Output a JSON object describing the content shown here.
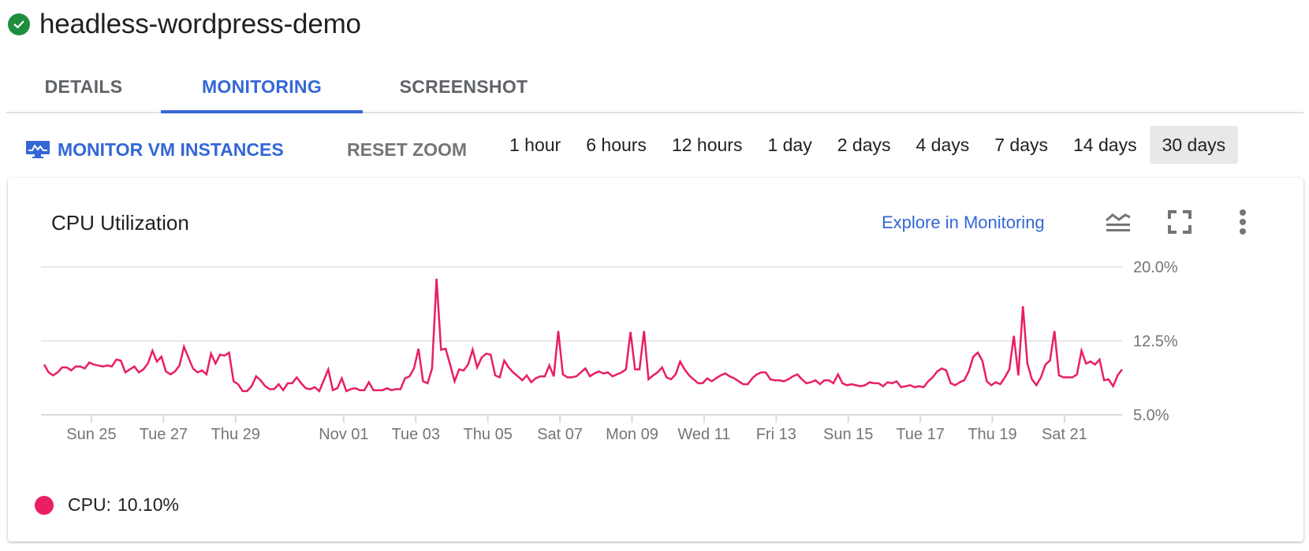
{
  "instance": {
    "name": "headless-wordpress-demo",
    "status_icon": "check-circle-icon",
    "status_color": "#1e8e3e"
  },
  "tabs": [
    {
      "label": "DETAILS",
      "active": false
    },
    {
      "label": "MONITORING",
      "active": true
    },
    {
      "label": "SCREENSHOT",
      "active": false
    }
  ],
  "toolbar": {
    "monitor_label": "MONITOR VM INSTANCES",
    "monitor_icon": "monitor-chart-icon",
    "reset_zoom_label": "RESET ZOOM",
    "ranges": [
      "1 hour",
      "6 hours",
      "12 hours",
      "1 day",
      "2 days",
      "4 days",
      "7 days",
      "14 days",
      "30 days"
    ],
    "selected_range": "30 days"
  },
  "card": {
    "title": "CPU Utilization",
    "explore_label": "Explore in Monitoring",
    "icons": [
      "legend-toggle-icon",
      "fullscreen-icon",
      "more-vert-icon"
    ]
  },
  "colors": {
    "accent": "#3367d6",
    "series": "#e91e63",
    "grid": "#e8e8e8",
    "axis_text": "#757575"
  },
  "legend": {
    "label": "CPU:",
    "value": "10.10%"
  },
  "chart_data": {
    "type": "line",
    "title": "CPU Utilization",
    "xlabel": "",
    "ylabel": "",
    "ylim": [
      5.0,
      20.0
    ],
    "yticks": [
      "5.0%",
      "12.5%",
      "20.0%"
    ],
    "ytick_values": [
      5.0,
      12.5,
      20.0
    ],
    "grid": true,
    "legend_position": "bottom-left",
    "x_range_days": [
      0,
      30
    ],
    "xticks": [
      {
        "label": "Sun 25",
        "day": 1.4
      },
      {
        "label": "Tue 27",
        "day": 3.4
      },
      {
        "label": "Thu 29",
        "day": 5.4
      },
      {
        "label": "Nov 01",
        "day": 8.4
      },
      {
        "label": "Tue 03",
        "day": 10.4
      },
      {
        "label": "Thu 05",
        "day": 12.4
      },
      {
        "label": "Sat 07",
        "day": 14.4
      },
      {
        "label": "Mon 09",
        "day": 16.4
      },
      {
        "label": "Wed 11",
        "day": 18.4
      },
      {
        "label": "Fri 13",
        "day": 20.4
      },
      {
        "label": "Sun 15",
        "day": 22.4
      },
      {
        "label": "Tue 17",
        "day": 24.4
      },
      {
        "label": "Thu 19",
        "day": 26.4
      },
      {
        "label": "Sat 21",
        "day": 28.4
      }
    ],
    "series": [
      {
        "name": "CPU",
        "color": "#e91e63",
        "values": [
          10.1,
          9.3,
          9.0,
          9.3,
          9.8,
          9.8,
          9.5,
          9.9,
          9.9,
          9.7,
          10.3,
          10.1,
          10.0,
          9.9,
          10.0,
          9.9,
          10.6,
          10.5,
          9.3,
          9.6,
          9.9,
          9.3,
          9.6,
          10.2,
          11.5,
          10.4,
          10.9,
          9.4,
          9.1,
          9.4,
          10.0,
          11.9,
          10.8,
          9.7,
          9.3,
          9.5,
          9.1,
          11.2,
          10.2,
          11.1,
          11.0,
          11.3,
          8.4,
          8.1,
          7.4,
          7.4,
          7.9,
          8.9,
          8.5,
          7.9,
          7.6,
          7.6,
          8.1,
          7.5,
          8.2,
          8.2,
          8.8,
          8.2,
          7.7,
          7.6,
          7.8,
          7.4,
          8.5,
          9.6,
          7.5,
          7.7,
          8.7,
          7.4,
          7.6,
          7.7,
          7.5,
          7.5,
          8.3,
          7.5,
          7.5,
          7.5,
          7.7,
          7.5,
          7.6,
          7.6,
          8.7,
          8.9,
          9.7,
          11.7,
          8.4,
          8.2,
          9.7,
          18.8,
          11.6,
          11.7,
          10.1,
          8.4,
          9.6,
          9.5,
          10.1,
          11.6,
          9.8,
          10.8,
          11.2,
          11.1,
          9.0,
          8.8,
          10.5,
          9.8,
          9.3,
          8.9,
          8.5,
          9.0,
          8.3,
          8.7,
          8.9,
          8.9,
          10.0,
          8.9,
          13.5,
          9.1,
          8.8,
          8.8,
          8.9,
          9.3,
          9.7,
          8.9,
          9.2,
          9.4,
          9.2,
          9.3,
          8.9,
          9.1,
          9.3,
          9.6,
          13.4,
          9.6,
          9.6,
          13.5,
          8.6,
          9.0,
          9.3,
          9.8,
          8.8,
          8.6,
          9.1,
          10.4,
          9.6,
          9.0,
          8.6,
          8.2,
          8.2,
          8.7,
          8.4,
          8.7,
          9.0,
          9.2,
          8.9,
          8.7,
          8.4,
          8.1,
          8.1,
          8.7,
          9.1,
          9.3,
          9.3,
          8.6,
          8.5,
          8.5,
          8.4,
          8.6,
          8.9,
          9.1,
          8.6,
          8.2,
          8.3,
          8.5,
          8.1,
          8.5,
          8.5,
          8.2,
          9.1,
          8.2,
          8.0,
          8.1,
          8.0,
          7.9,
          8.0,
          8.3,
          8.2,
          8.2,
          7.9,
          8.3,
          8.2,
          8.4,
          7.8,
          7.9,
          8.0,
          7.8,
          7.9,
          7.8,
          8.4,
          8.8,
          9.4,
          9.7,
          9.5,
          8.2,
          8.0,
          8.3,
          8.5,
          9.4,
          10.9,
          11.3,
          10.5,
          8.4,
          8.0,
          8.3,
          8.1,
          8.8,
          9.6,
          13.0,
          9.0,
          16.0,
          10.2,
          8.6,
          8.0,
          8.8,
          10.1,
          10.5,
          13.5,
          9.0,
          8.8,
          8.8,
          8.8,
          9.1,
          11.5,
          10.2,
          10.4,
          10.1,
          10.6,
          8.5,
          8.6,
          7.9,
          9.0,
          9.6
        ]
      }
    ]
  }
}
